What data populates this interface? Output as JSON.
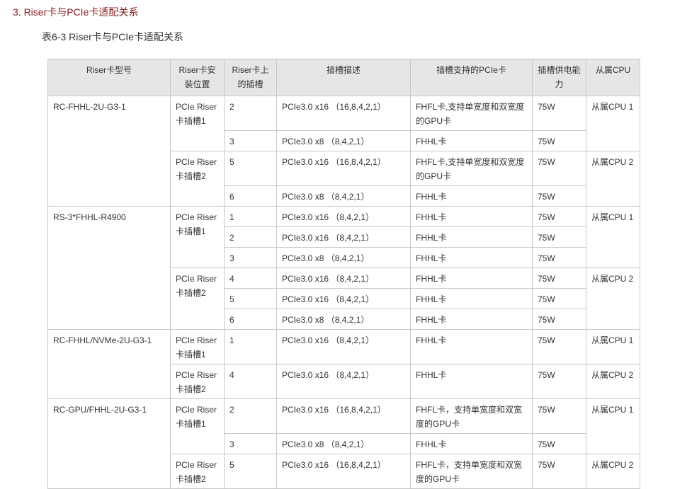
{
  "heading": "3. Riser卡与PCIe卡适配关系",
  "caption": "表6-3 Riser卡与PCIe卡适配关系",
  "columns": {
    "model": "Riser卡型号",
    "position": "Riser卡安装位置",
    "slot": "Riser卡上的插槽",
    "slot_desc": "插槽描述",
    "supported": "插槽支持的PCIe卡",
    "power": "插槽供电能力",
    "cpu": "从属CPU"
  },
  "rows": [
    {
      "model": "RC-FHHL-2U-G3-1",
      "position": "PCIe Riser卡插槽1",
      "slot": "2",
      "desc": "PCIe3.0 x16 （16,8,4,2,1）",
      "card": "FHFL卡,支持单宽度和双宽度的GPU卡",
      "power": "75W",
      "cpu": "从属CPU 1"
    },
    {
      "slot": "3",
      "desc": "PCIe3.0 x8 （8,4,2,1）",
      "card": "FHHL卡",
      "power": "75W"
    },
    {
      "position": "PCIe Riser卡插槽2",
      "slot": "5",
      "desc": "PCIe3.0 x16 （16,8,4,2,1）",
      "card": "FHFL卡,支持单宽度和双宽度的GPU卡",
      "power": "75W",
      "cpu": "从属CPU 2"
    },
    {
      "slot": "6",
      "desc": "PCIe3.0 x8 （8,4,2,1）",
      "card": "FHHL卡",
      "power": "75W"
    },
    {
      "model": "RS-3*FHHL-R4900",
      "position": "PCIe Riser卡插槽1",
      "slot": "1",
      "desc": "PCIe3.0 x16 （8,4,2,1）",
      "card": "FHHL卡",
      "power": "75W",
      "cpu": "从属CPU 1"
    },
    {
      "slot": "2",
      "desc": "PCIe3.0 x16 （8,4,2,1）",
      "card": "FHHL卡",
      "power": "75W"
    },
    {
      "slot": "3",
      "desc": "PCIe3.0 x8 （8,4,2,1）",
      "card": "FHHL卡",
      "power": "75W"
    },
    {
      "position": "PCIe Riser卡插槽2",
      "slot": "4",
      "desc": "PCIe3.0 x16 （8,4,2,1）",
      "card": "FHHL卡",
      "power": "75W",
      "cpu": "从属CPU 2"
    },
    {
      "slot": "5",
      "desc": "PCIe3.0 x16 （8,4,2,1）",
      "card": "FHHL卡",
      "power": "75W"
    },
    {
      "slot": "6",
      "desc": "PCIe3.0 x8 （8,4,2,1）",
      "card": "FHHL卡",
      "power": "75W"
    },
    {
      "model": "RC-FHHL/NVMe-2U-G3-1",
      "position": "PCIe Riser卡插槽1",
      "slot": "1",
      "desc": "PCIe3.0 x16 （8,4,2,1）",
      "card": "FHHL卡",
      "power": "75W",
      "cpu": "从属CPU 1"
    },
    {
      "position": "PCIe Riser卡插槽2",
      "slot": "4",
      "desc": "PCIe3.0 x16 （8,4,2,1）",
      "card": "FHHL卡",
      "power": "75W",
      "cpu": "从属CPU 2"
    },
    {
      "model": "RC-GPU/FHHL-2U-G3-1",
      "position": "PCIe Riser卡插槽1",
      "slot": "2",
      "desc": "PCIe3.0 x16 （16,8,4,2,1）",
      "card": "FHFL卡，支持单宽度和双宽度的GPU卡",
      "power": "75W",
      "cpu": "从属CPU 1"
    },
    {
      "slot": "3",
      "desc": "PCIe3.0 x8 （8,4,2,1）",
      "card": "FHHL卡",
      "power": "75W"
    },
    {
      "position": "PCIe Riser卡插槽2",
      "slot": "5",
      "desc": "PCIe3.0 x16 （16,8,4,2,1）",
      "card": "FHFL卡，支持单宽度和双宽度的GPU卡",
      "power": "75W",
      "cpu": "从属CPU 2"
    }
  ]
}
